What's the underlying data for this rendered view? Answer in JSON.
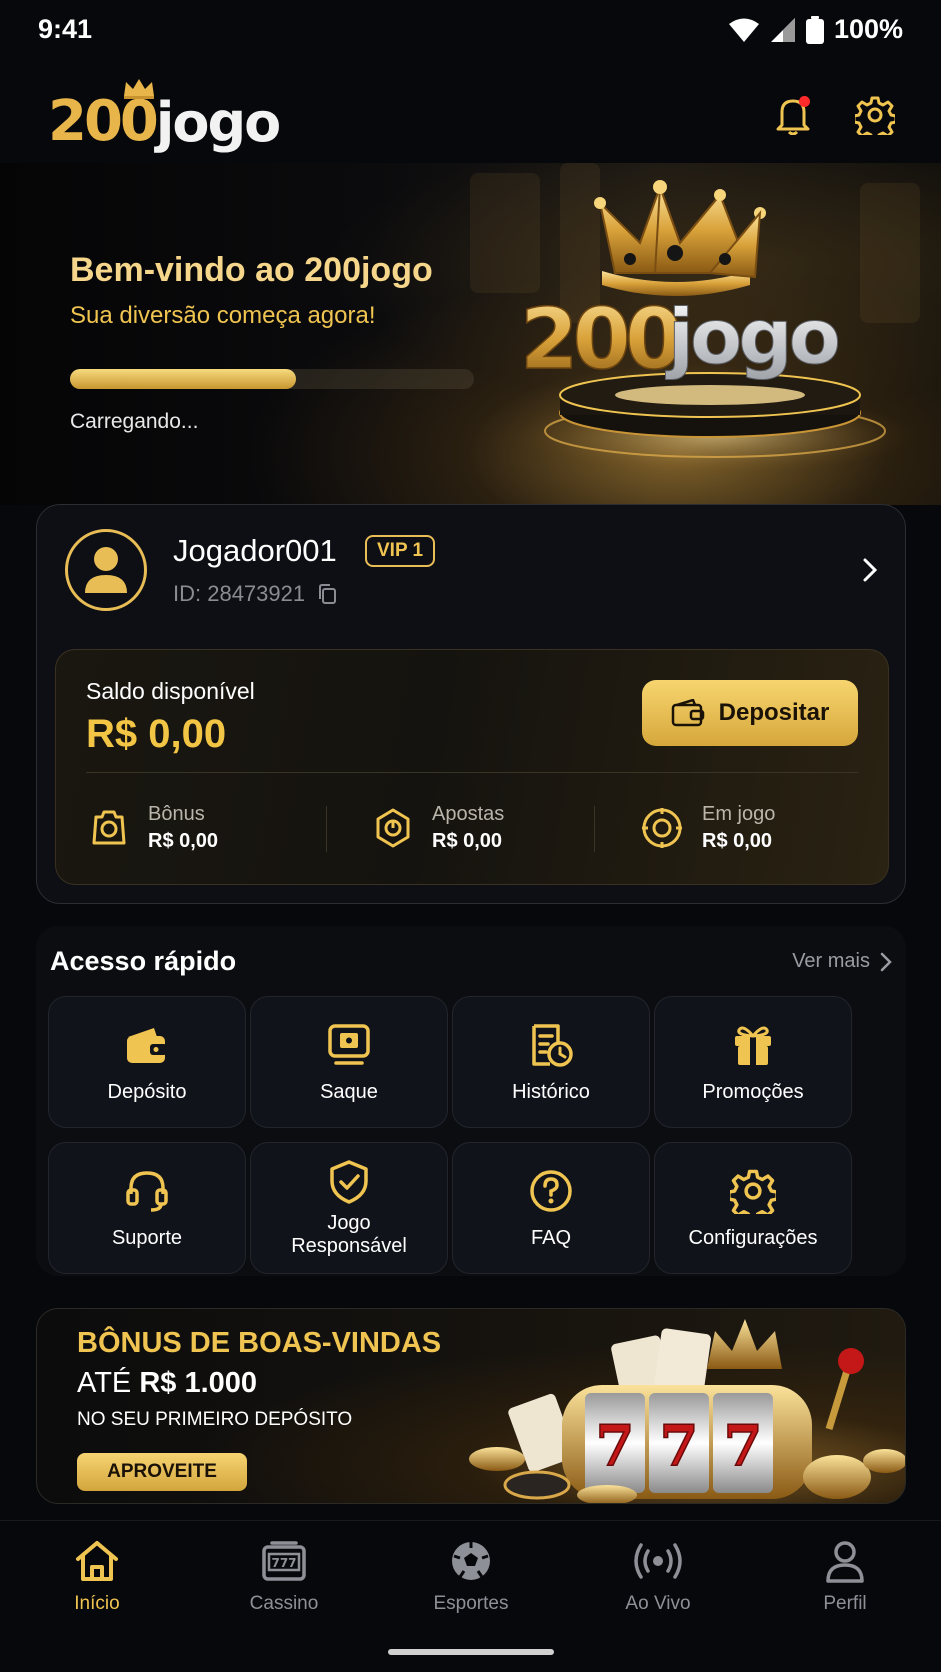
{
  "status": {
    "time": "9:41",
    "battery": "100%"
  },
  "header": {
    "logo_num": "200",
    "logo_word": "jogo",
    "notification_dot": true
  },
  "hero": {
    "title": "Bem-vindo ao 200jogo",
    "subtitle": "Sua diversão começa agora!",
    "progress": 0.56,
    "loading_text": "Carregando...",
    "art_num": "200",
    "art_word": "jogo"
  },
  "profile": {
    "name": "Jogador001",
    "vip": "VIP 1",
    "id": "ID: 28473921"
  },
  "balance": {
    "label": "Saldo disponível",
    "value": "R$ 0,00",
    "deposit_label": "Depositar",
    "stats": [
      {
        "label": "Bônus",
        "value": "R$ 0,00",
        "icon": "bonus-icon"
      },
      {
        "label": "Apostas",
        "value": "R$ 0,00",
        "icon": "bets-icon"
      },
      {
        "label": "Em jogo",
        "value": "R$ 0,00",
        "icon": "in-game-icon"
      }
    ]
  },
  "quick_access": {
    "title": "Acesso rápido",
    "more": "Ver mais",
    "items": [
      {
        "label": "Depósito",
        "icon": "wallet-icon"
      },
      {
        "label": "Saque",
        "icon": "withdraw-icon"
      },
      {
        "label": "Histórico",
        "icon": "history-icon"
      },
      {
        "label": "Promoções",
        "icon": "gift-icon"
      },
      {
        "label": "Suporte",
        "icon": "headset-icon"
      },
      {
        "label": "Jogo\nResponsável",
        "icon": "shield-icon"
      },
      {
        "label": "FAQ",
        "icon": "question-icon"
      },
      {
        "label": "Configurações",
        "icon": "gear-icon"
      }
    ]
  },
  "promo": {
    "line1": "BÔNUS DE BOAS-VINDAS",
    "line2_prefix": "ATÉ ",
    "line2_amount": "R$ 1.000",
    "line3": "NO SEU PRIMEIRO DEPÓSITO",
    "cta": "APROVEITE",
    "slot_digits": [
      "7",
      "7",
      "7"
    ]
  },
  "nav": {
    "items": [
      {
        "label": "Início",
        "icon": "home-icon",
        "active": true
      },
      {
        "label": "Cassino",
        "icon": "slot-machine-icon",
        "active": false
      },
      {
        "label": "Esportes",
        "icon": "soccer-ball-icon",
        "active": false
      },
      {
        "label": "Ao Vivo",
        "icon": "live-broadcast-icon",
        "active": false
      },
      {
        "label": "Perfil",
        "icon": "profile-icon",
        "active": false
      }
    ]
  },
  "colors": {
    "accent": "#f0c451",
    "background": "#07080b",
    "card": "#0d0f14"
  }
}
